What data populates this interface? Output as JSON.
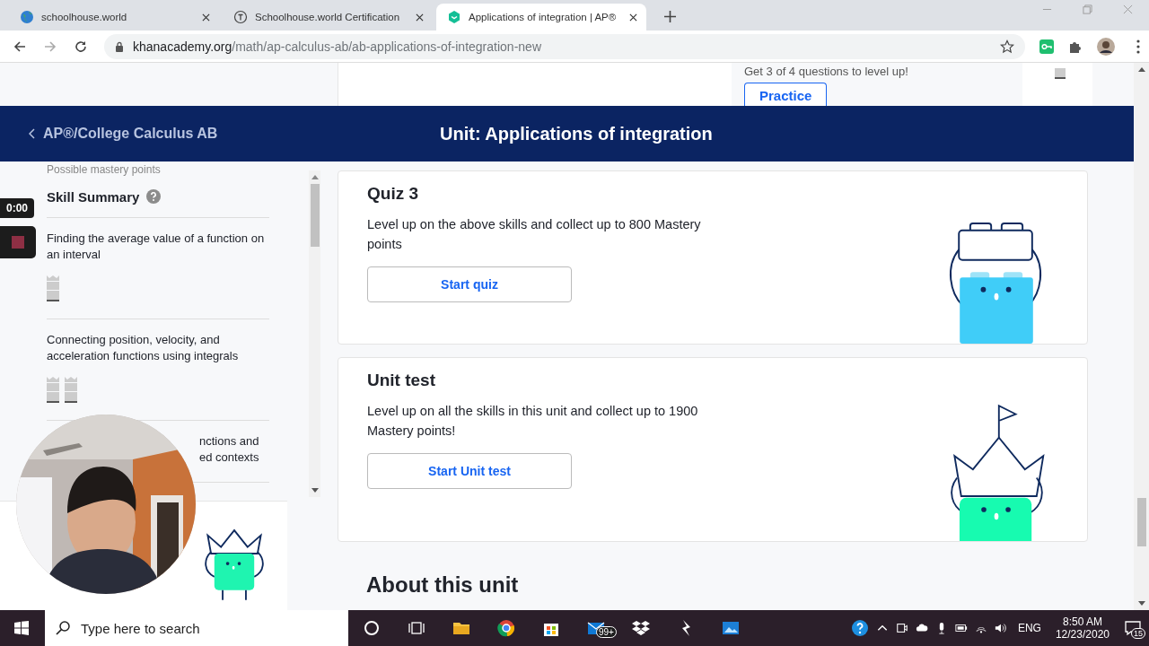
{
  "browser": {
    "tabs": [
      {
        "title": "schoolhouse.world",
        "selected": false
      },
      {
        "title": "Schoolhouse.world Certification",
        "selected": false
      },
      {
        "title": "Applications of integration | AP®",
        "selected": true
      }
    ],
    "url": {
      "domain": "khanacademy.org",
      "path": "/math/ap-calculus-ab/ab-applications-of-integration-new"
    }
  },
  "partial_card": {
    "text": "Get 3 of 4 questions to level up!",
    "button": "Practice"
  },
  "header": {
    "back_link": "AP®/College Calculus AB",
    "title": "Unit: Applications of integration"
  },
  "recorder": {
    "timer": "0:00"
  },
  "sidebar": {
    "caption": "Possible mastery points",
    "heading": "Skill Summary",
    "skills": [
      {
        "title": "Finding the average value of a function on an interval",
        "icons": [
          {
            "kind": "tower"
          }
        ]
      },
      {
        "title": "Connecting position, velocity, and acceleration functions using integrals",
        "icons": [
          {
            "kind": "tower"
          },
          {
            "kind": "tower"
          }
        ]
      },
      {
        "title": "nctions and\ned contexts"
      }
    ]
  },
  "cards": [
    {
      "kind": "quiz",
      "title": "Quiz 3",
      "description": "Level up on the above skills and collect up to 800 Mastery points",
      "button": "Start quiz"
    },
    {
      "kind": "unit_test",
      "title": "Unit test",
      "description": "Level up on all the skills in this unit and collect up to 1900 Mastery points!",
      "button": "Start Unit test"
    }
  ],
  "about": {
    "heading": "About this unit"
  },
  "taskbar": {
    "search_placeholder": "Type here to search",
    "mail_badge": "99+",
    "language": "ENG",
    "time": "8:50 AM",
    "date": "12/23/2020",
    "notifications": "15"
  }
}
